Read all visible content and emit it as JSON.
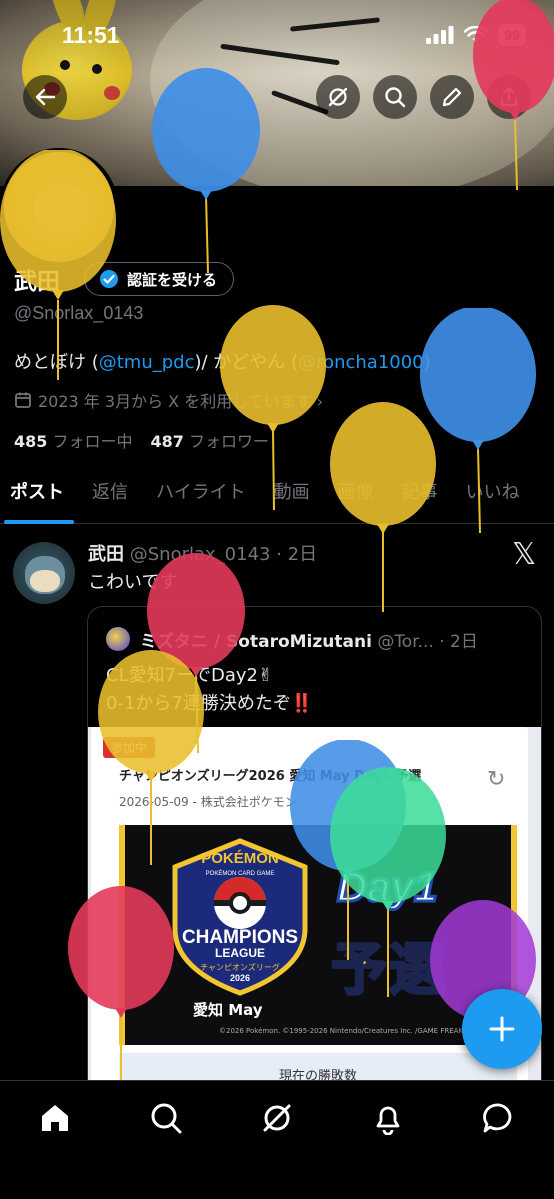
{
  "status_bar": {
    "time": "11:51",
    "battery": "99"
  },
  "profile": {
    "name": "武田",
    "verify_label": "認証を受ける",
    "handle": "@Snorlax_0143",
    "bio_prefix": "めとぼけ (",
    "bio_link1": "@tmu_pdc",
    "bio_mid": ")/ かどやん (",
    "bio_link2": "@roncha1000",
    "bio_suffix": ")",
    "joined": "2023 年 3月から X を利用しています ›",
    "following_count": "485",
    "following_label": "フォロー中",
    "followers_count": "487",
    "followers_label": "フォロワー"
  },
  "tabs": [
    "ポスト",
    "返信",
    "ハイライト",
    "動画",
    "画像",
    "記事",
    "いいね"
  ],
  "post": {
    "author": "武田",
    "meta": "@Snorlax_0143 · 2日",
    "text": "こわいです",
    "quote": {
      "author": "ミズタニ / SotaroMizutani",
      "meta": "@Tor... · 2日",
      "line1": "CL愛知7ーでDay2✌",
      "line2": "0-1から7連勝決めたぞ",
      "line2_emoji": "‼️",
      "image": {
        "badge": "参加中",
        "title": "チャンピオンズリーグ2026 愛知 May Day1 予選",
        "date": "2026-05-09 - 株式会社ポケモン",
        "logo_top": "POKÉMON",
        "logo_sub": "POKÉMON CARD GAME",
        "logo_main1": "CHAMPIONS",
        "logo_main2": "LEAGUE",
        "logo_jp": "チャンピオンズリーグ",
        "logo_year": "2026",
        "day": "Day1",
        "yosen": "予選",
        "location": "愛知 May",
        "copyright": "©2026 Pokémon. ©1995-2026 Nintendo/Creatures Inc. /GAME FREAK inc.",
        "record_label": "現在の勝敗数"
      }
    }
  },
  "icons": {
    "back": "back-arrow-icon",
    "grok": "grok-icon",
    "search": "search-icon",
    "edit": "pencil-icon",
    "share": "share-icon",
    "verified": "verified-badge-icon",
    "calendar": "calendar-icon",
    "x_logo": "x-logo-icon",
    "compose": "plus-icon",
    "nav": [
      "home-icon",
      "search-icon",
      "grok-icon",
      "bell-icon",
      "message-icon"
    ]
  },
  "colors": {
    "accent": "#1d9bf0",
    "balloon_yellow": "#e9bf2e",
    "balloon_blue": "#3f8ee6",
    "balloon_red": "#e33a5b",
    "balloon_green": "#3ddc97",
    "balloon_purple": "#a23ad6"
  },
  "balloons": [
    {
      "color": "red"
    },
    {
      "color": "blue"
    },
    {
      "color": "yellow"
    },
    {
      "color": "yellow"
    },
    {
      "color": "yellow"
    },
    {
      "color": "blue"
    },
    {
      "color": "red"
    },
    {
      "color": "yellow"
    },
    {
      "color": "blue"
    },
    {
      "color": "green"
    },
    {
      "color": "red"
    },
    {
      "color": "purple"
    },
    {
      "color": "red"
    }
  ]
}
